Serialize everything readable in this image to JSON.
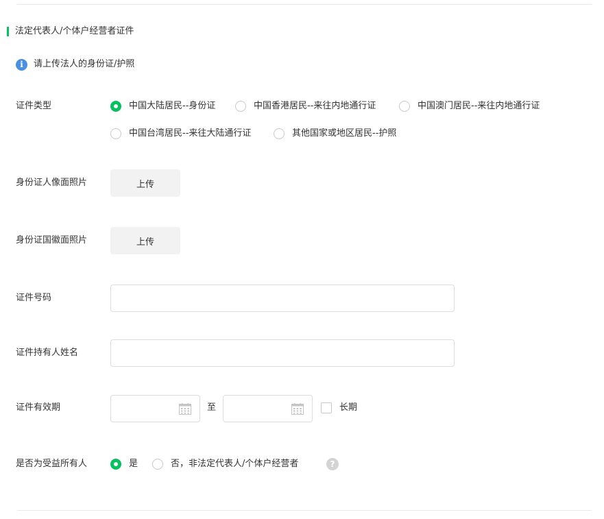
{
  "section": {
    "title": "法定代表人/个体户经营者证件",
    "accent_color": "#07c160"
  },
  "notice": {
    "icon": "info-icon",
    "icon_glyph": "i",
    "text": "请上传法人的身份证/护照"
  },
  "id_type": {
    "label": "证件类型",
    "options": [
      {
        "label": "中国大陆居民--身份证",
        "selected": true
      },
      {
        "label": "中国香港居民--来往内地通行证",
        "selected": false
      },
      {
        "label": "中国澳门居民--来往内地通行证",
        "selected": false
      },
      {
        "label": "中国台湾居民--来往大陆通行证",
        "selected": false
      },
      {
        "label": "其他国家或地区居民--护照",
        "selected": false
      }
    ]
  },
  "id_front": {
    "label": "身份证人像面照片",
    "button": "上传"
  },
  "id_back": {
    "label": "身份证国徽面照片",
    "button": "上传"
  },
  "id_number": {
    "label": "证件号码",
    "value": ""
  },
  "holder_name": {
    "label": "证件持有人姓名",
    "value": ""
  },
  "validity": {
    "label": "证件有效期",
    "start": "",
    "end": "",
    "separator": "至",
    "long_term_label": "长期",
    "long_term_checked": false,
    "calendar_icon": "calendar-icon"
  },
  "beneficiary": {
    "label": "是否为受益所有人",
    "options": [
      {
        "label": "是",
        "selected": true
      },
      {
        "label": "否，非法定代表人/个体户经营者",
        "selected": false
      }
    ],
    "help_icon": "question-icon",
    "help_glyph": "?"
  }
}
